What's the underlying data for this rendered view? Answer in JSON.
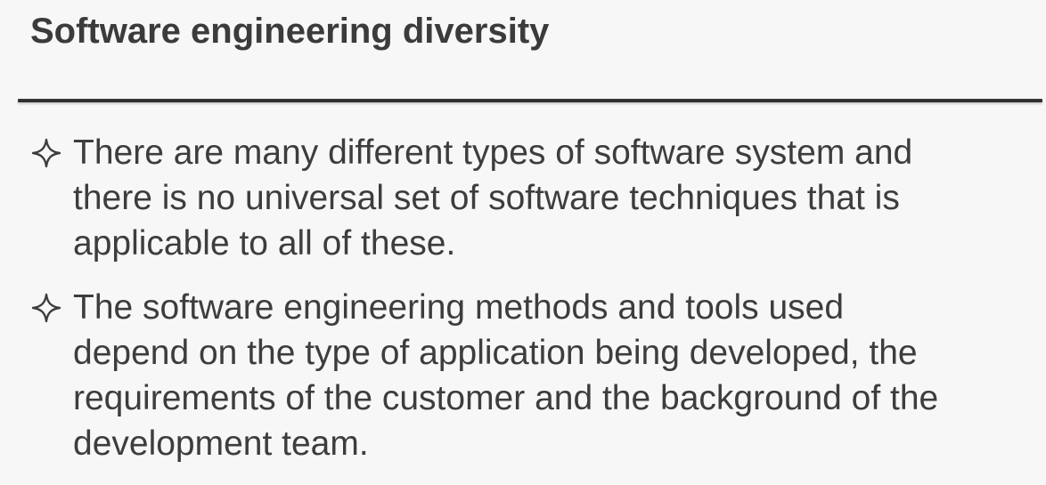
{
  "slide": {
    "title": "Software engineering diversity",
    "bullets": [
      {
        "icon": "four-point-star-outline-icon",
        "text": "There are many different types of software system and\nthere is no universal set of software techniques that is\napplicable to all of these."
      },
      {
        "icon": "four-point-star-outline-icon",
        "text": "The software engineering methods and tools used\ndepend on the type of application being developed, the\nrequirements of the customer and the background of the\ndevelopment team."
      }
    ]
  },
  "colors": {
    "background": "#f7f7f7",
    "text": "#3d3d3d",
    "rule": "#2f2f2f"
  }
}
